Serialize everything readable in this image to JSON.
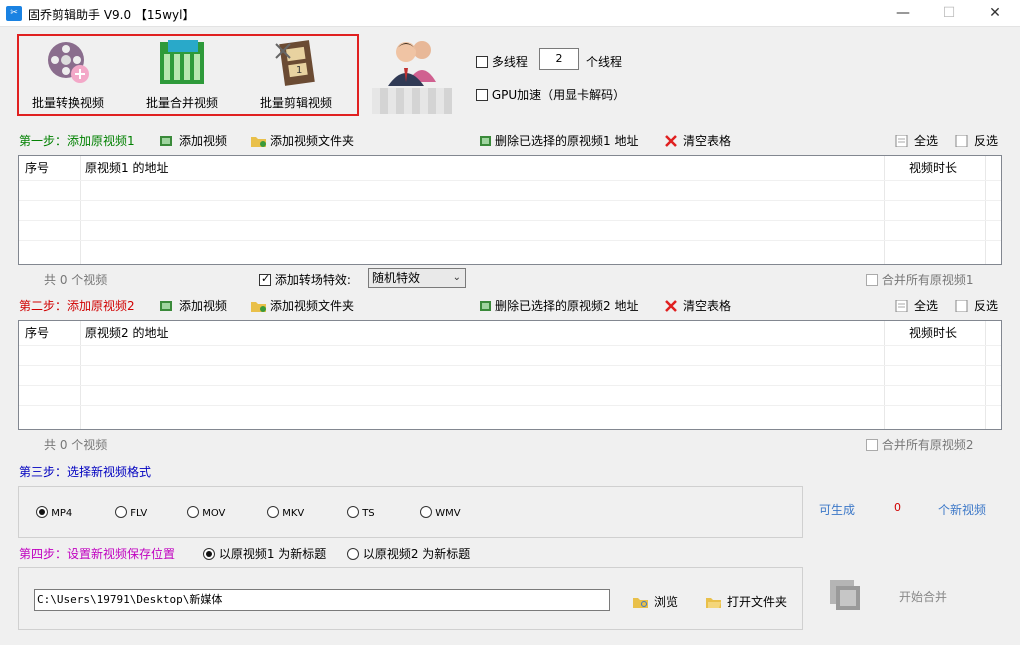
{
  "window": {
    "title": "固乔剪辑助手 V9.0  【15wyl】",
    "minimize_glyph": "—",
    "maximize_glyph": "☐",
    "close_glyph": "✕"
  },
  "toolbar": {
    "convert_label": "批量转换视频",
    "merge_label": "批量合并视频",
    "cut_label": "批量剪辑视频"
  },
  "options": {
    "multithread_label": "多线程",
    "thread_count": "2",
    "thread_unit": "个线程",
    "gpu_label": "GPU加速（用显卡解码）"
  },
  "step1": {
    "title": "第一步：添加原视频1",
    "add_video": "添加视频",
    "add_folder": "添加视频文件夹",
    "delete_selected": "删除已选择的原视频1 地址",
    "clear_table": "清空表格",
    "select_all": "全选",
    "invert": "反选",
    "columns": [
      "序号",
      "原视频1 的地址",
      "视频时长"
    ],
    "count_text": "共 0 个视频",
    "transition_label": "添加转场特效:",
    "transition_value": "随机特效",
    "merge_all": "合并所有原视频1"
  },
  "step2": {
    "title": "第二步：添加原视频2",
    "add_video": "添加视频",
    "add_folder": "添加视频文件夹",
    "delete_selected": "删除已选择的原视频2 地址",
    "clear_table": "清空表格",
    "select_all": "全选",
    "invert": "反选",
    "columns": [
      "序号",
      "原视频2 的地址",
      "视频时长"
    ],
    "count_text": "共 0 个视频",
    "merge_all": "合并所有原视频2"
  },
  "step3": {
    "title": "第三步：选择新视频格式",
    "formats": [
      "MP4",
      "FLV",
      "MOV",
      "MKV",
      "TS",
      "WMV"
    ],
    "selected": "MP4",
    "can_generate": "可生成",
    "generate_count": "0",
    "new_videos": "个新视频"
  },
  "step4": {
    "title": "第四步：设置新视频保存位置",
    "title_option1": "以原视频1 为新标题",
    "title_option2": "以原视频2 为新标题",
    "path": "C:\\Users\\19791\\Desktop\\新媒体",
    "browse": "浏览",
    "open_folder": "打开文件夹",
    "start": "开始合并"
  },
  "colors": {
    "step1": "#008000",
    "step2": "#d00000",
    "step3": "#0000c0",
    "step4": "#c000c0",
    "highlight": "#e02020",
    "accent_blue": "#3c78c8"
  }
}
